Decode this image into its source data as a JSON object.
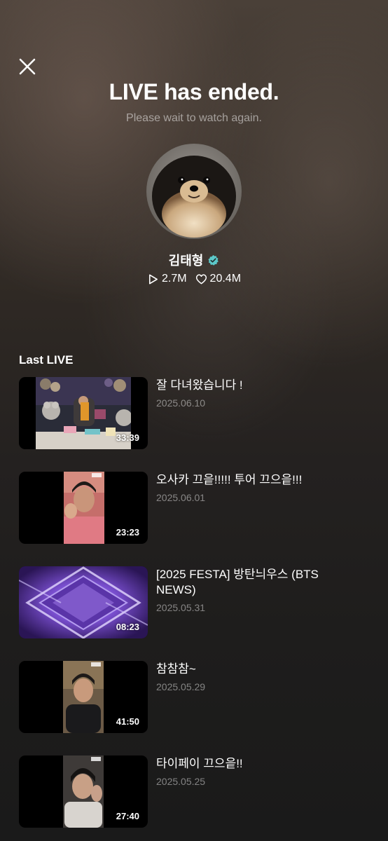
{
  "header": {
    "title": "LIVE has ended.",
    "subtitle": "Please wait to watch again."
  },
  "profile": {
    "name": "김태형",
    "verified": true,
    "play_count": "2.7M",
    "like_count": "20.4M"
  },
  "section_title": "Last LIVE",
  "lives": [
    {
      "title": "잘 다녀왔습니다 !",
      "date": "2025.06.10",
      "duration": "33:39"
    },
    {
      "title": "오사카 끄읕!!!!! 투어 끄으읕!!!",
      "date": "2025.06.01",
      "duration": "23:23"
    },
    {
      "title": "[2025 FESTA] 방탄늬우스 (BTS NEWS)",
      "date": "2025.05.31",
      "duration": "08:23"
    },
    {
      "title": "참참참~",
      "date": "2025.05.29",
      "duration": "41:50"
    },
    {
      "title": "타이페이 끄으읕!!",
      "date": "2025.05.25",
      "duration": "27:40"
    }
  ],
  "colors": {
    "verified_badge": "#5cc8c8",
    "date_text": "#8a8a8a"
  },
  "icons": [
    "close-icon",
    "verified-icon",
    "play-icon",
    "heart-icon"
  ]
}
